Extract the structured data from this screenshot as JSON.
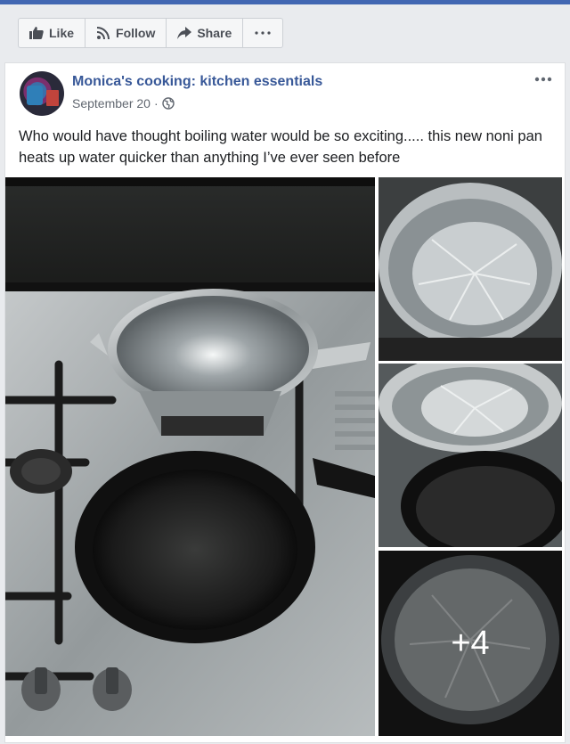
{
  "actions": {
    "like_label": "Like",
    "follow_label": "Follow",
    "share_label": "Share"
  },
  "post": {
    "page_name": "Monica's cooking: kitchen essentials",
    "date": "September 20",
    "separator": "·",
    "audience_icon": "globe-icon",
    "text": "Who would have thought boiling water would be so exciting..... this new noni pan heats up water quicker than anything I’ve ever seen before",
    "more_photos_label": "+4"
  },
  "colors": {
    "brand": "#4267b2",
    "link": "#385898",
    "background": "#e9ebee"
  }
}
